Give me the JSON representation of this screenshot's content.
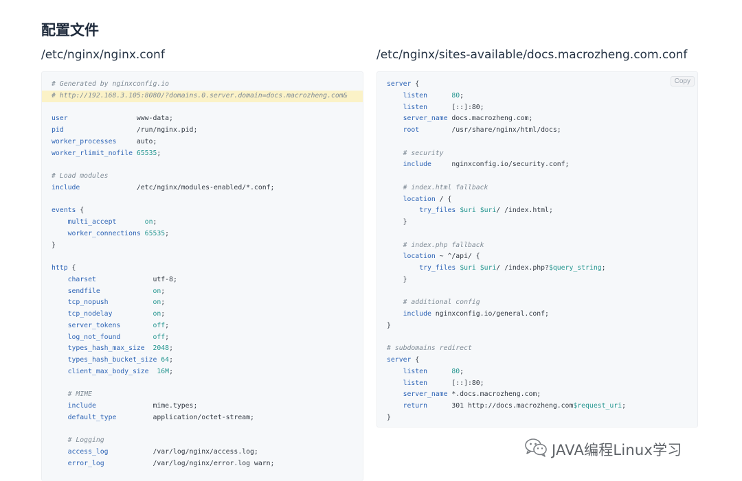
{
  "page": {
    "title": "配置文件"
  },
  "left_file": {
    "path": "/etc/nginx/nginx.conf",
    "lines": [
      [
        {
          "t": "c",
          "v": "# Generated by nginxconfig.io"
        }
      ],
      {
        "hl": true,
        "tokens": [
          {
            "t": "c",
            "v": "# http://192.168.3.105:8080/?domains.0.server.domain=docs.macrozheng.com&"
          }
        ]
      },
      [],
      [
        {
          "t": "k",
          "v": "user"
        },
        {
          "t": "p",
          "v": "                 www-data;"
        }
      ],
      [
        {
          "t": "k",
          "v": "pid"
        },
        {
          "t": "p",
          "v": "                  /run/nginx.pid;"
        }
      ],
      [
        {
          "t": "k",
          "v": "worker_processes"
        },
        {
          "t": "p",
          "v": "     auto;"
        }
      ],
      [
        {
          "t": "k",
          "v": "worker_rlimit_nofile"
        },
        {
          "t": "p",
          "v": " "
        },
        {
          "t": "n",
          "v": "65535"
        },
        {
          "t": "p",
          "v": ";"
        }
      ],
      [],
      [
        {
          "t": "c",
          "v": "# Load modules"
        }
      ],
      [
        {
          "t": "k",
          "v": "include"
        },
        {
          "t": "p",
          "v": "              /etc/nginx/modules-enabled/*.conf;"
        }
      ],
      [],
      [
        {
          "t": "k",
          "v": "events"
        },
        {
          "t": "p",
          "v": " {"
        }
      ],
      [
        {
          "t": "p",
          "v": "    "
        },
        {
          "t": "k",
          "v": "multi_accept"
        },
        {
          "t": "p",
          "v": "       "
        },
        {
          "t": "n",
          "v": "on"
        },
        {
          "t": "p",
          "v": ";"
        }
      ],
      [
        {
          "t": "p",
          "v": "    "
        },
        {
          "t": "k",
          "v": "worker_connections"
        },
        {
          "t": "p",
          "v": " "
        },
        {
          "t": "n",
          "v": "65535"
        },
        {
          "t": "p",
          "v": ";"
        }
      ],
      [
        {
          "t": "p",
          "v": "}"
        }
      ],
      [],
      [
        {
          "t": "k",
          "v": "http"
        },
        {
          "t": "p",
          "v": " {"
        }
      ],
      [
        {
          "t": "p",
          "v": "    "
        },
        {
          "t": "k",
          "v": "charset"
        },
        {
          "t": "p",
          "v": "              utf-8;"
        }
      ],
      [
        {
          "t": "p",
          "v": "    "
        },
        {
          "t": "k",
          "v": "sendfile"
        },
        {
          "t": "p",
          "v": "             "
        },
        {
          "t": "n",
          "v": "on"
        },
        {
          "t": "p",
          "v": ";"
        }
      ],
      [
        {
          "t": "p",
          "v": "    "
        },
        {
          "t": "k",
          "v": "tcp_nopush"
        },
        {
          "t": "p",
          "v": "           "
        },
        {
          "t": "n",
          "v": "on"
        },
        {
          "t": "p",
          "v": ";"
        }
      ],
      [
        {
          "t": "p",
          "v": "    "
        },
        {
          "t": "k",
          "v": "tcp_nodelay"
        },
        {
          "t": "p",
          "v": "          "
        },
        {
          "t": "n",
          "v": "on"
        },
        {
          "t": "p",
          "v": ";"
        }
      ],
      [
        {
          "t": "p",
          "v": "    "
        },
        {
          "t": "k",
          "v": "server_tokens"
        },
        {
          "t": "p",
          "v": "        "
        },
        {
          "t": "n",
          "v": "off"
        },
        {
          "t": "p",
          "v": ";"
        }
      ],
      [
        {
          "t": "p",
          "v": "    "
        },
        {
          "t": "k",
          "v": "log_not_found"
        },
        {
          "t": "p",
          "v": "        "
        },
        {
          "t": "n",
          "v": "off"
        },
        {
          "t": "p",
          "v": ";"
        }
      ],
      [
        {
          "t": "p",
          "v": "    "
        },
        {
          "t": "k",
          "v": "types_hash_max_size"
        },
        {
          "t": "p",
          "v": "  "
        },
        {
          "t": "n",
          "v": "2048"
        },
        {
          "t": "p",
          "v": ";"
        }
      ],
      [
        {
          "t": "p",
          "v": "    "
        },
        {
          "t": "k",
          "v": "types_hash_bucket_size"
        },
        {
          "t": "p",
          "v": " "
        },
        {
          "t": "n",
          "v": "64"
        },
        {
          "t": "p",
          "v": ";"
        }
      ],
      [
        {
          "t": "p",
          "v": "    "
        },
        {
          "t": "k",
          "v": "client_max_body_size"
        },
        {
          "t": "p",
          "v": "  "
        },
        {
          "t": "n",
          "v": "16M"
        },
        {
          "t": "p",
          "v": ";"
        }
      ],
      [],
      [
        {
          "t": "p",
          "v": "    "
        },
        {
          "t": "c",
          "v": "# MIME"
        }
      ],
      [
        {
          "t": "p",
          "v": "    "
        },
        {
          "t": "k",
          "v": "include"
        },
        {
          "t": "p",
          "v": "              mime.types;"
        }
      ],
      [
        {
          "t": "p",
          "v": "    "
        },
        {
          "t": "k",
          "v": "default_type"
        },
        {
          "t": "p",
          "v": "         application/octet-stream;"
        }
      ],
      [],
      [
        {
          "t": "p",
          "v": "    "
        },
        {
          "t": "c",
          "v": "# Logging"
        }
      ],
      [
        {
          "t": "p",
          "v": "    "
        },
        {
          "t": "k",
          "v": "access_log"
        },
        {
          "t": "p",
          "v": "           /var/log/nginx/access.log;"
        }
      ],
      [
        {
          "t": "p",
          "v": "    "
        },
        {
          "t": "k",
          "v": "error_log"
        },
        {
          "t": "p",
          "v": "            /var/log/nginx/error.log warn;"
        }
      ]
    ]
  },
  "right_file": {
    "path": "/etc/nginx/sites-available/docs.macrozheng.com.conf",
    "copy_label": "Copy",
    "lines": [
      [
        {
          "t": "k",
          "v": "server"
        },
        {
          "t": "p",
          "v": " {"
        }
      ],
      [
        {
          "t": "p",
          "v": "    "
        },
        {
          "t": "k",
          "v": "listen"
        },
        {
          "t": "p",
          "v": "      "
        },
        {
          "t": "n",
          "v": "80"
        },
        {
          "t": "p",
          "v": ";"
        }
      ],
      [
        {
          "t": "p",
          "v": "    "
        },
        {
          "t": "k",
          "v": "listen"
        },
        {
          "t": "p",
          "v": "      [::]:80;"
        }
      ],
      [
        {
          "t": "p",
          "v": "    "
        },
        {
          "t": "k",
          "v": "server_name"
        },
        {
          "t": "p",
          "v": " docs.macrozheng.com;"
        }
      ],
      [
        {
          "t": "p",
          "v": "    "
        },
        {
          "t": "k",
          "v": "root"
        },
        {
          "t": "p",
          "v": "        /usr/share/nginx/html/docs;"
        }
      ],
      [],
      [
        {
          "t": "p",
          "v": "    "
        },
        {
          "t": "c",
          "v": "# security"
        }
      ],
      [
        {
          "t": "p",
          "v": "    "
        },
        {
          "t": "k",
          "v": "include"
        },
        {
          "t": "p",
          "v": "     nginxconfig.io/security.conf;"
        }
      ],
      [],
      [
        {
          "t": "p",
          "v": "    "
        },
        {
          "t": "c",
          "v": "# index.html fallback"
        }
      ],
      [
        {
          "t": "p",
          "v": "    "
        },
        {
          "t": "k",
          "v": "location"
        },
        {
          "t": "p",
          "v": " / {"
        }
      ],
      [
        {
          "t": "p",
          "v": "        "
        },
        {
          "t": "k",
          "v": "try_files"
        },
        {
          "t": "p",
          "v": " "
        },
        {
          "t": "v",
          "v": "$uri"
        },
        {
          "t": "p",
          "v": " "
        },
        {
          "t": "v",
          "v": "$uri"
        },
        {
          "t": "p",
          "v": "/ /index.html;"
        }
      ],
      [
        {
          "t": "p",
          "v": "    }"
        }
      ],
      [],
      [
        {
          "t": "p",
          "v": "    "
        },
        {
          "t": "c",
          "v": "# index.php fallback"
        }
      ],
      [
        {
          "t": "p",
          "v": "    "
        },
        {
          "t": "k",
          "v": "location"
        },
        {
          "t": "p",
          "v": " ~ ^/api/ {"
        }
      ],
      [
        {
          "t": "p",
          "v": "        "
        },
        {
          "t": "k",
          "v": "try_files"
        },
        {
          "t": "p",
          "v": " "
        },
        {
          "t": "v",
          "v": "$uri"
        },
        {
          "t": "p",
          "v": " "
        },
        {
          "t": "v",
          "v": "$uri"
        },
        {
          "t": "p",
          "v": "/ /index.php?"
        },
        {
          "t": "v",
          "v": "$query_string"
        },
        {
          "t": "p",
          "v": ";"
        }
      ],
      [
        {
          "t": "p",
          "v": "    }"
        }
      ],
      [],
      [
        {
          "t": "p",
          "v": "    "
        },
        {
          "t": "c",
          "v": "# additional config"
        }
      ],
      [
        {
          "t": "p",
          "v": "    "
        },
        {
          "t": "k",
          "v": "include"
        },
        {
          "t": "p",
          "v": " nginxconfig.io/general.conf;"
        }
      ],
      [
        {
          "t": "p",
          "v": "}"
        }
      ],
      [],
      [
        {
          "t": "c",
          "v": "# subdomains redirect"
        }
      ],
      [
        {
          "t": "k",
          "v": "server"
        },
        {
          "t": "p",
          "v": " {"
        }
      ],
      [
        {
          "t": "p",
          "v": "    "
        },
        {
          "t": "k",
          "v": "listen"
        },
        {
          "t": "p",
          "v": "      "
        },
        {
          "t": "n",
          "v": "80"
        },
        {
          "t": "p",
          "v": ";"
        }
      ],
      [
        {
          "t": "p",
          "v": "    "
        },
        {
          "t": "k",
          "v": "listen"
        },
        {
          "t": "p",
          "v": "      [::]:80;"
        }
      ],
      [
        {
          "t": "p",
          "v": "    "
        },
        {
          "t": "k",
          "v": "server_name"
        },
        {
          "t": "p",
          "v": " *.docs.macrozheng.com;"
        }
      ],
      [
        {
          "t": "p",
          "v": "    "
        },
        {
          "t": "k",
          "v": "return"
        },
        {
          "t": "p",
          "v": "      301 http://docs.macrozheng.com"
        },
        {
          "t": "v",
          "v": "$request_uri"
        },
        {
          "t": "p",
          "v": ";"
        }
      ],
      [
        {
          "t": "p",
          "v": "}"
        }
      ]
    ]
  },
  "watermark": {
    "icon": "wechat-icon",
    "text": "JAVA编程Linux学习"
  },
  "colors": {
    "code_background": "#f6f8fa",
    "keyword": "#2c63b5",
    "comment": "#7f8b96",
    "number": "#23958f",
    "highlight": "#fbf2c7"
  }
}
